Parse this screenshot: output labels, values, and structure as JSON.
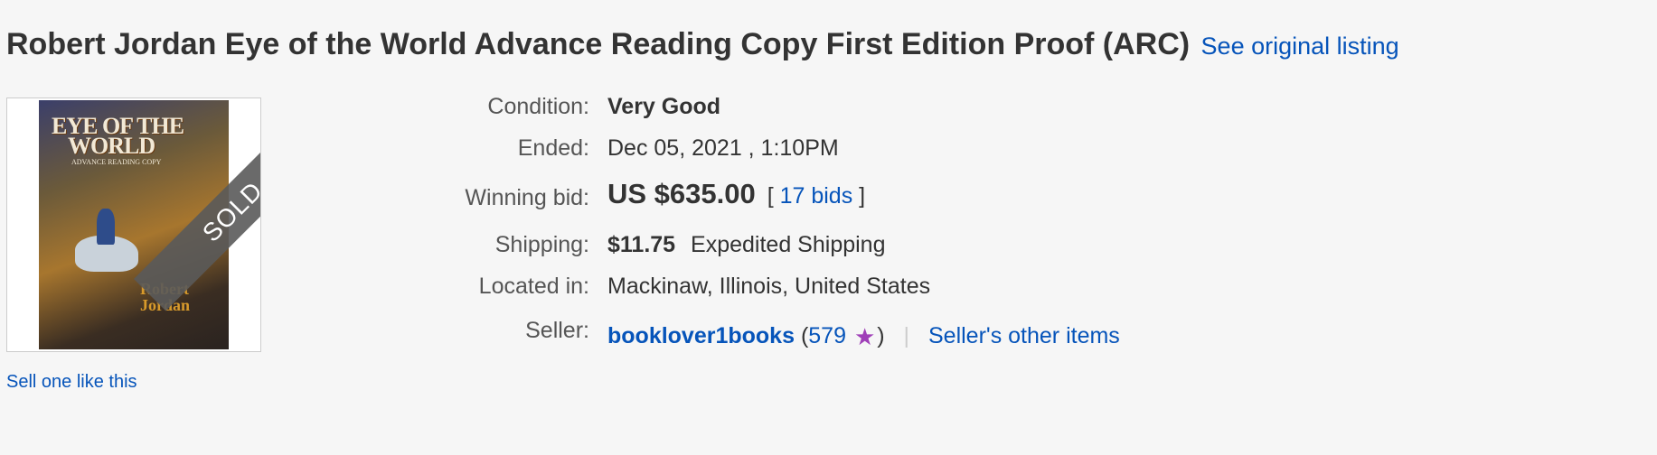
{
  "listing": {
    "title": "Robert Jordan Eye of the World Advance Reading Copy First Edition Proof (ARC)",
    "see_original": "See original listing",
    "sell_one": "Sell one like this"
  },
  "image": {
    "cover_title_line1": "EYE OF THE",
    "cover_title_line2": "WORLD",
    "cover_subtitle": "ADVANCE READING COPY",
    "cover_author_line1": "Robert",
    "cover_author_line2": "Jordan",
    "sold_label": "SOLD"
  },
  "details": {
    "condition": {
      "label": "Condition:",
      "value": "Very Good"
    },
    "ended": {
      "label": "Ended:",
      "value": "Dec 05, 2021 , 1:10PM"
    },
    "winning_bid": {
      "label": "Winning bid:",
      "price": "US $635.00",
      "bracket_open": "[",
      "bids": "17 bids",
      "bracket_close": "]"
    },
    "shipping": {
      "label": "Shipping:",
      "cost": "$11.75",
      "type": "Expedited Shipping"
    },
    "located": {
      "label": "Located in:",
      "value": "Mackinaw, Illinois, United States"
    },
    "seller": {
      "label": "Seller:",
      "name": "booklover1books",
      "paren_open": "(",
      "feedback": "579",
      "paren_close": ")",
      "separator": "|",
      "other_items": "Seller's other items"
    }
  },
  "colors": {
    "link": "#0654ba",
    "star": "#9f3fb8",
    "background": "#f6f6f6"
  },
  "icons": {
    "feedback_star": "purple-star-icon"
  }
}
